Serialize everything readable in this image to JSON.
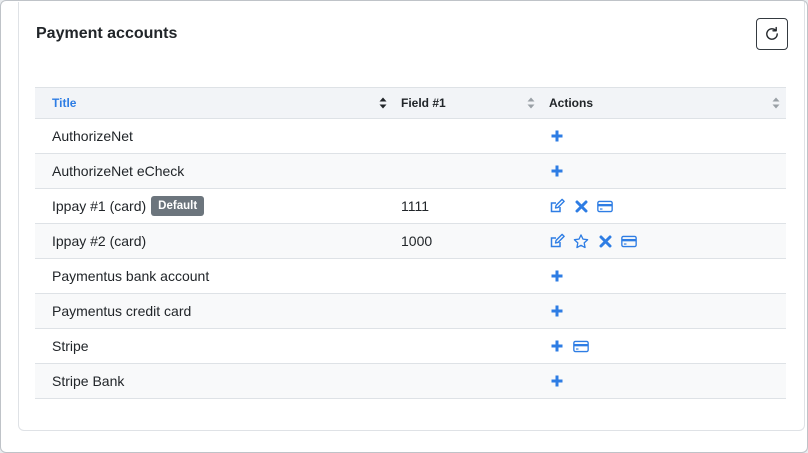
{
  "card": {
    "title": "Payment accounts",
    "refresh_icon": "refresh-icon"
  },
  "table": {
    "headers": {
      "title": "Title",
      "field1": "Field #1",
      "actions": "Actions"
    },
    "rows": [
      {
        "title": "AuthorizeNet",
        "badge": "",
        "field1": "",
        "actions": [
          "add"
        ]
      },
      {
        "title": "AuthorizeNet eCheck",
        "badge": "",
        "field1": "",
        "actions": [
          "add"
        ]
      },
      {
        "title": "Ippay #1 (card)",
        "badge": "Default",
        "field1": "1111",
        "actions": [
          "edit",
          "delete",
          "card"
        ]
      },
      {
        "title": "Ippay #2 (card)",
        "badge": "",
        "field1": "1000",
        "actions": [
          "edit",
          "star",
          "delete",
          "card"
        ]
      },
      {
        "title": "Paymentus bank account",
        "badge": "",
        "field1": "",
        "actions": [
          "add"
        ]
      },
      {
        "title": "Paymentus credit card",
        "badge": "",
        "field1": "",
        "actions": [
          "add"
        ]
      },
      {
        "title": "Stripe",
        "badge": "",
        "field1": "",
        "actions": [
          "add",
          "card"
        ]
      },
      {
        "title": "Stripe Bank",
        "badge": "",
        "field1": "",
        "actions": [
          "add"
        ]
      }
    ]
  },
  "colors": {
    "accent": "#2e7de4",
    "badge_bg": "#6c757d",
    "header_bg": "#f2f4f7",
    "row_alt_bg": "#f8f9fa"
  }
}
